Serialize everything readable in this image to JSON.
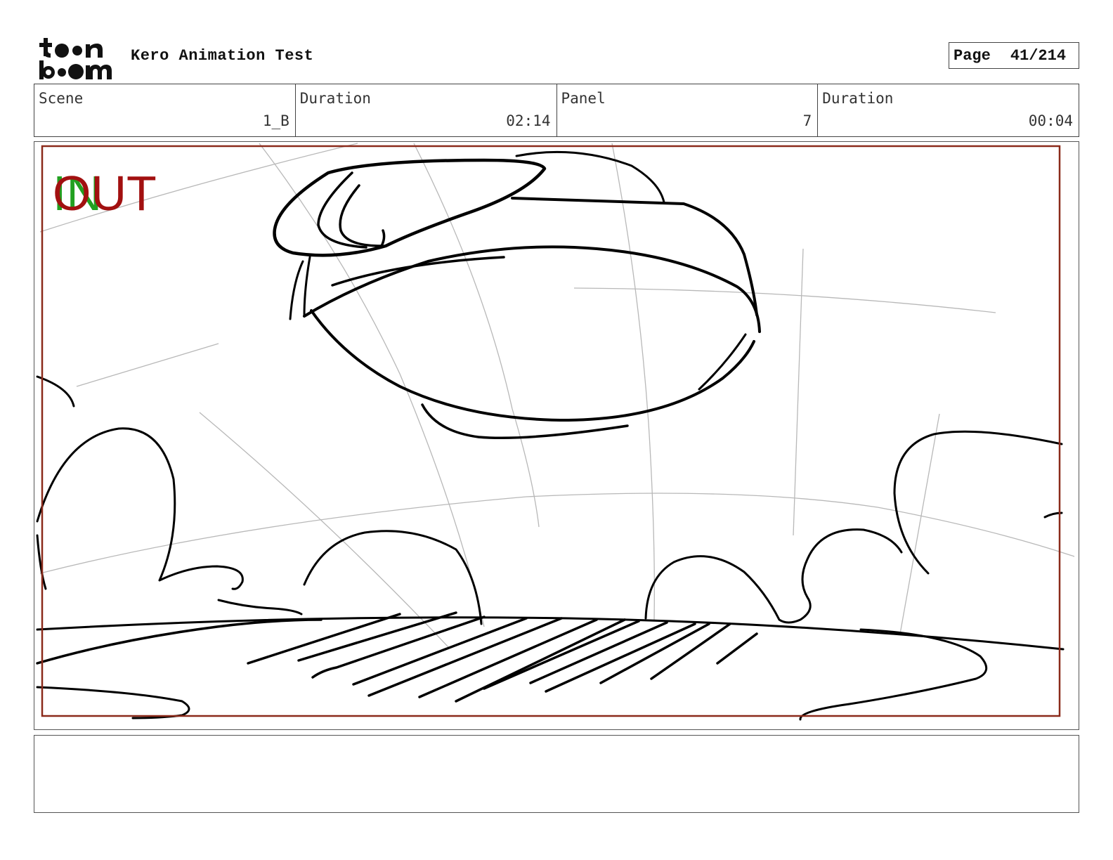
{
  "header": {
    "logo": {
      "line1": "toon",
      "line2": "boom",
      "brand": "Toon Boom"
    },
    "project_title": "Kero Animation Test",
    "page_label": "Page",
    "page_value": "41/214"
  },
  "info": {
    "scene_label": "Scene",
    "scene_value": "1_B",
    "scene_duration_label": "Duration",
    "scene_duration_value": "02:14",
    "panel_label": "Panel",
    "panel_value": "7",
    "panel_duration_label": "Duration",
    "panel_duration_value": "00:04"
  },
  "panel": {
    "transition_in": "IN",
    "transition_out": "OUT",
    "colors": {
      "in": "#22a020",
      "out": "#a21010",
      "safe_frame": "#8b2a1a",
      "sketch": "#000000",
      "guides": "#b0b0b0"
    }
  },
  "notes": {
    "text": ""
  }
}
